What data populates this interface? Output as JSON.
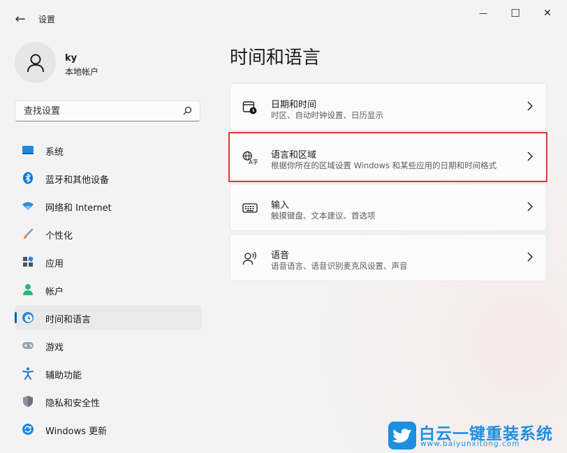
{
  "window": {
    "title": "设置",
    "back_glyph": "←",
    "minimize_glyph": "—",
    "maximize_glyph": "☐",
    "close_glyph": "✕"
  },
  "profile": {
    "name": "ky",
    "account_type": "本地帐户"
  },
  "search": {
    "placeholder": "查找设置"
  },
  "sidebar": {
    "items": [
      {
        "label": "系统",
        "icon": "monitor-icon",
        "color": "#1e88e5"
      },
      {
        "label": "蓝牙和其他设备",
        "icon": "bluetooth-icon",
        "color": "#0078d4"
      },
      {
        "label": "网络和 Internet",
        "icon": "wifi-icon",
        "color": "#2a8ae0"
      },
      {
        "label": "个性化",
        "icon": "brush-icon",
        "color": "#e8784a"
      },
      {
        "label": "应用",
        "icon": "apps-icon",
        "color": "#4a5568"
      },
      {
        "label": "帐户",
        "icon": "person-icon",
        "color": "#2bb57a"
      },
      {
        "label": "时间和语言",
        "icon": "globe-clock-icon",
        "color": "#1e88e5",
        "selected": true
      },
      {
        "label": "游戏",
        "icon": "gamepad-icon",
        "color": "#7a7a7a"
      },
      {
        "label": "辅助功能",
        "icon": "accessibility-icon",
        "color": "#1e73c9"
      },
      {
        "label": "隐私和安全性",
        "icon": "shield-icon",
        "color": "#6b7280"
      },
      {
        "label": "Windows 更新",
        "icon": "update-icon",
        "color": "#1e88e5"
      }
    ]
  },
  "main": {
    "title": "时间和语言",
    "cards": [
      {
        "title": "日期和时间",
        "subtitle": "时区、自动时钟设置、日历显示",
        "icon": "calendar-clock-icon"
      },
      {
        "title": "语言和区域",
        "subtitle": "根据你所在的区域设置 Windows 和某些应用的日期和时间格式",
        "icon": "language-icon",
        "highlighted": true
      },
      {
        "title": "输入",
        "subtitle": "触摸键盘、文本建议、首选项",
        "icon": "keyboard-icon"
      },
      {
        "title": "语音",
        "subtitle": "语音语言、语音识别麦克风设置、声音",
        "icon": "speech-icon"
      }
    ]
  },
  "watermark": {
    "text": "白云一键重装系统",
    "url": "www.baiyunxitong.com",
    "color": "#1d8fe0"
  },
  "colors": {
    "accent": "#005fb8",
    "highlight_border": "#e03a3a"
  }
}
